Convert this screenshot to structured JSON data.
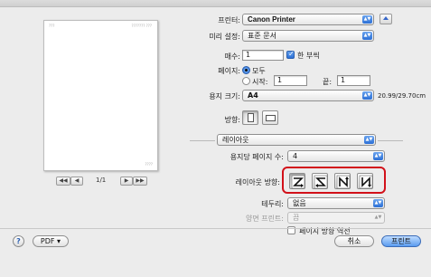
{
  "preview": {
    "page_header_left": "???",
    "page_header_right": "??????? ???",
    "page_footer": "????",
    "first_btn": "◀◀",
    "prev_btn": "◀",
    "next_btn": "▶",
    "last_btn": "▶▶",
    "page_indicator": "1/1"
  },
  "printer": {
    "label": "프린터:",
    "value": "Canon Printer"
  },
  "presets": {
    "label": "미리 설정:",
    "value": "표준 문서"
  },
  "copies": {
    "label": "매수:",
    "value": "1",
    "collate_label": "한 부씩",
    "collate_checked": true
  },
  "pages": {
    "label": "페이지:",
    "all_label": "모두",
    "from_label": "시작:",
    "from_value": "1",
    "to_label": "끝:",
    "to_value": "1"
  },
  "paper_size": {
    "label": "용지 크기:",
    "value": "A4",
    "dimensions": "20.99/29.70cm"
  },
  "orientation": {
    "label": "방향:"
  },
  "section": {
    "value": "레이아웃"
  },
  "pages_per_sheet": {
    "label": "용지당 페이지 수:",
    "value": "4"
  },
  "layout_direction": {
    "label": "레이아웃 방향:"
  },
  "border": {
    "label": "테두리:",
    "value": "없음"
  },
  "duplex": {
    "label": "양면 프린트:",
    "value": "끔"
  },
  "reverse": {
    "label": "페이지 방향 역전",
    "checked": false
  },
  "footer": {
    "help": "?",
    "pdf_label": "PDF ▾",
    "cancel_label": "취소",
    "print_label": "프린트"
  }
}
